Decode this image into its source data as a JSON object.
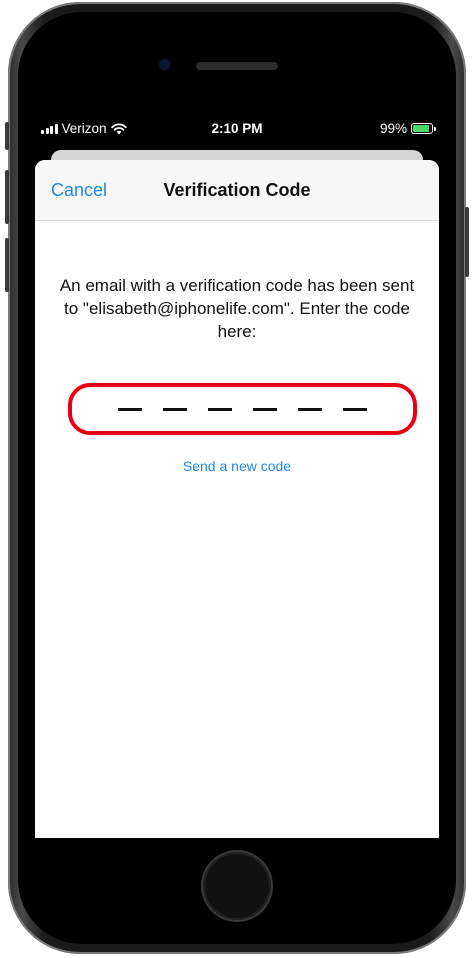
{
  "status_bar": {
    "carrier": "Verizon",
    "time": "2:10 PM",
    "battery_percent": "99%",
    "battery_level": 0.99,
    "icons": [
      "signal-icon",
      "wifi-icon",
      "battery-charging-icon"
    ]
  },
  "nav": {
    "cancel_label": "Cancel",
    "title": "Verification Code"
  },
  "content": {
    "message": "An email with a verification code has been sent to \"elisabeth@iphonelife.com\". Enter the code here:",
    "code_digits": [
      "",
      "",
      "",
      "",
      "",
      ""
    ],
    "resend_label": "Send a new code"
  },
  "colors": {
    "accent": "#1e88e5",
    "highlight_outline": "#e60012",
    "battery_green": "#4cd964"
  }
}
